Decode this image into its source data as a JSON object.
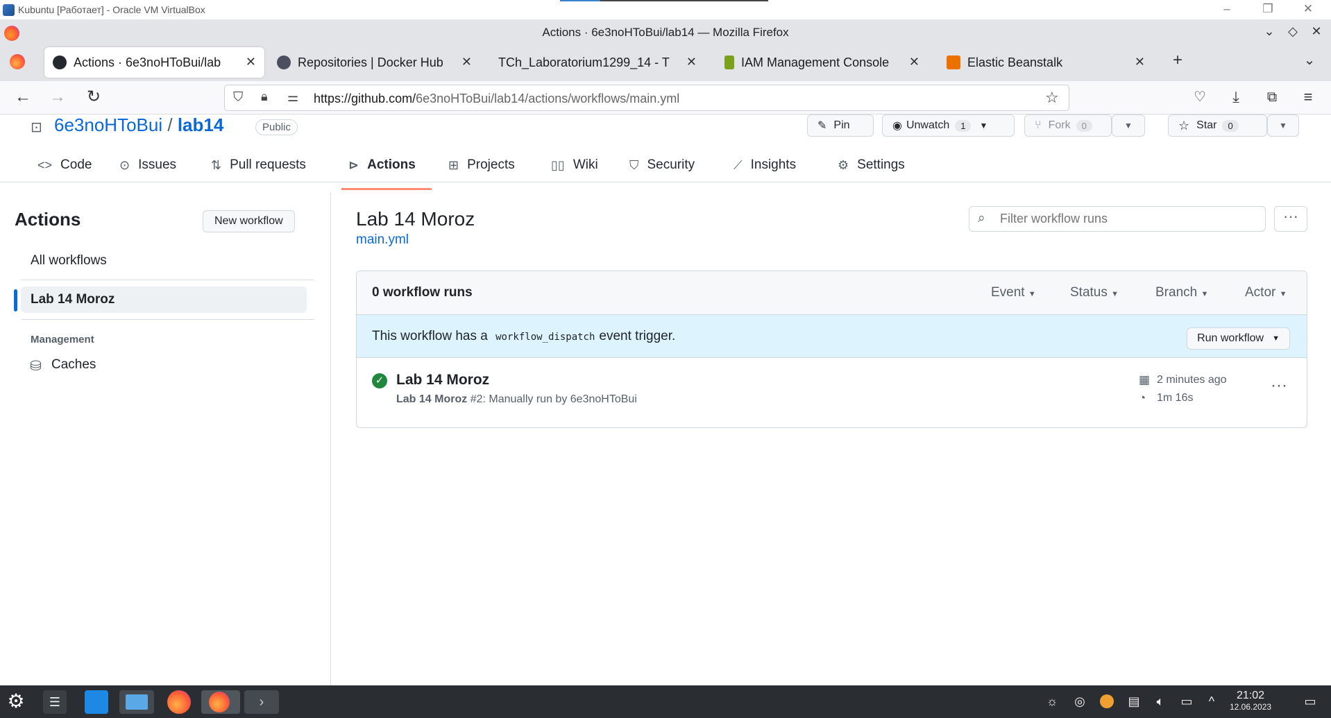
{
  "vbox": {
    "title": "Kubuntu [Работает] - Oracle VM VirtualBox"
  },
  "window": {
    "title": "Actions · 6e3noHToBui/lab14 — Mozilla Firefox"
  },
  "tabs": [
    {
      "label": "Actions · 6e3noHToBui/lab",
      "active": true
    },
    {
      "label": "Repositories | Docker Hub"
    },
    {
      "label": "TCh_Laboratorium1299_14 - T"
    },
    {
      "label": "IAM Management Console"
    },
    {
      "label": "Elastic Beanstalk"
    }
  ],
  "url": {
    "host": "https://github.com/",
    "path": "6e3noHToBui/lab14/actions/workflows/main.yml"
  },
  "repo": {
    "owner": "6e3noHToBui",
    "separator": "/",
    "name": "lab14",
    "visibility": "Public",
    "pin_label": "Pin",
    "watch_label": "Unwatch",
    "watch_count": "1",
    "fork_label": "Fork",
    "fork_count": "0",
    "star_label": "Star",
    "star_count": "0"
  },
  "repo_nav": [
    {
      "label": "Code",
      "icon": "code-icon"
    },
    {
      "label": "Issues",
      "icon": "issue-icon"
    },
    {
      "label": "Pull requests",
      "icon": "pull-request-icon"
    },
    {
      "label": "Actions",
      "icon": "play-icon",
      "active": true
    },
    {
      "label": "Projects",
      "icon": "table-icon"
    },
    {
      "label": "Wiki",
      "icon": "book-icon"
    },
    {
      "label": "Security",
      "icon": "shield-icon"
    },
    {
      "label": "Insights",
      "icon": "graph-icon"
    },
    {
      "label": "Settings",
      "icon": "gear-icon"
    }
  ],
  "sidebar": {
    "title": "Actions",
    "new_workflow": "New workflow",
    "all_workflows": "All workflows",
    "selected": "Lab 14 Moroz",
    "management_label": "Management",
    "caches": "Caches"
  },
  "workflow": {
    "title": "Lab 14 Moroz",
    "file": "main.yml",
    "filter_placeholder": "Filter workflow runs",
    "run_count": "0 workflow runs",
    "filters": [
      "Event",
      "Status",
      "Branch",
      "Actor"
    ],
    "banner_prefix": "This workflow has a",
    "banner_code": "workflow_dispatch",
    "banner_suffix": "event trigger.",
    "run_button": "Run workflow"
  },
  "run": {
    "title": "Lab 14 Moroz",
    "sub_bold": "Lab 14 Moroz",
    "sub_rest": "#2: Manually run by 6e3noHToBui",
    "time_ago": "2 minutes ago",
    "duration": "1m 16s",
    "status": "success"
  },
  "taskbar": {
    "time": "21:02",
    "date": "12.06.2023"
  },
  "colors": {
    "accent": "#0969da",
    "success": "#1f883d",
    "underline": "#fd8c73",
    "banner": "#ddf4ff"
  }
}
